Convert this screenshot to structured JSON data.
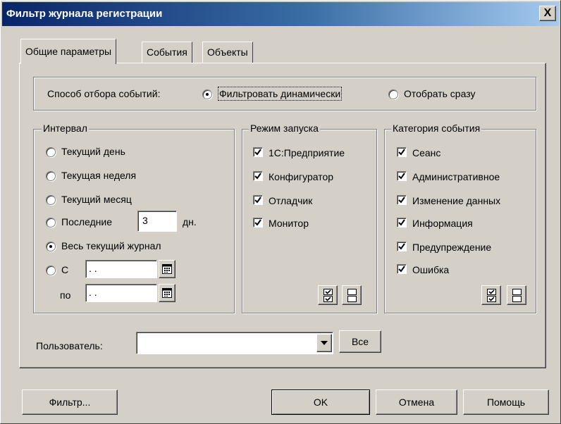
{
  "window": {
    "title": "Фильтр журнала регистрации",
    "close_label": "X"
  },
  "tabs": [
    {
      "label": "Общие параметры",
      "active": true
    },
    {
      "label": "События",
      "active": false
    },
    {
      "label": "Объекты",
      "active": false
    }
  ],
  "selection_mode": {
    "label": "Способ отбора событий:",
    "options": [
      {
        "label": "Фильтровать динамически",
        "selected": true
      },
      {
        "label": "Отобрать сразу",
        "selected": false
      }
    ]
  },
  "interval": {
    "title": "Интервал",
    "options": [
      {
        "label": "Текущий день",
        "selected": false
      },
      {
        "label": "Текущая неделя",
        "selected": false
      },
      {
        "label": "Текущий месяц",
        "selected": false
      },
      {
        "label": "Последние",
        "selected": false
      },
      {
        "label": "Весь текущий журнал",
        "selected": true
      },
      {
        "label": "С",
        "selected": false
      }
    ],
    "last_days_value": "3",
    "days_suffix": "дн.",
    "from_value": " . .",
    "to_label": "по",
    "to_value": " . ."
  },
  "launch_mode": {
    "title": "Режим запуска",
    "items": [
      {
        "label": "1С:Предприятие",
        "checked": true
      },
      {
        "label": "Конфигуратор",
        "checked": true
      },
      {
        "label": "Отладчик",
        "checked": true
      },
      {
        "label": "Монитор",
        "checked": true
      }
    ]
  },
  "event_category": {
    "title": "Категория события",
    "items": [
      {
        "label": "Сеанс",
        "checked": true
      },
      {
        "label": "Административное",
        "checked": true
      },
      {
        "label": "Изменение данных",
        "checked": true
      },
      {
        "label": "Информация",
        "checked": true
      },
      {
        "label": "Предупреждение",
        "checked": true
      },
      {
        "label": "Ошибка",
        "checked": true
      }
    ]
  },
  "user": {
    "label": "Пользователь:",
    "value": "",
    "all_button": "Все"
  },
  "footer": {
    "filter_button": "Фильтр...",
    "ok_button": "OK",
    "cancel_button": "Отмена",
    "help_button": "Помощь"
  }
}
